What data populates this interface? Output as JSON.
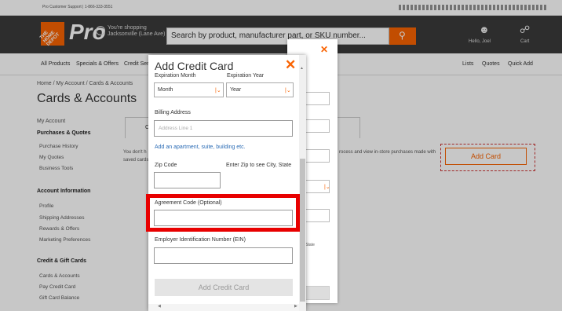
{
  "topbar": {
    "support": "Pro Customer Support | 1-866-333-3551"
  },
  "header": {
    "logo_text": "THE HOME DEPOT",
    "pro_label": "Pro",
    "location_line1": "You're shopping",
    "location_line2": "Jacksonville (Lane Ave)",
    "search_placeholder": "Search by product, manufacturer part, or SKU number...",
    "account_label": "Hello, Joel",
    "cart_label": "Cart"
  },
  "nav": {
    "items": [
      "All Products",
      "Specials & Offers",
      "Credit Servi"
    ],
    "right_items": [
      "Lists",
      "Quotes",
      "Quick Add"
    ]
  },
  "breadcrumb": "Home / My Account / Cards & Accounts",
  "page_title": "Cards & Accounts",
  "sidebar": {
    "my_account": "My Account",
    "purchases_head": "Purchases & Quotes",
    "purchases_items": [
      "Purchase History",
      "My Quotes",
      "Business Tools"
    ],
    "account_head": "Account Information",
    "account_items": [
      "Profile",
      "Shipping Addresses",
      "Rewards & Offers",
      "Marketing Preferences"
    ],
    "credit_head": "Credit & Gift Cards",
    "credit_items": [
      "Cards & Accounts",
      "Pay Credit Card",
      "Gift Card Balance"
    ]
  },
  "main": {
    "tab_label": "C",
    "msg_line1": "You don't h",
    "msg_line2": "saved cards",
    "msg_right": "rocess and view in-store purchases made with",
    "add_card_label": "Add Card"
  },
  "back_modal": {
    "zip_hint": "e City, State"
  },
  "modal": {
    "title": "Add Credit Card",
    "expiration_month_label": "Expiration Month",
    "expiration_year_label": "Expiration Year",
    "month_value": "Month",
    "year_value": "Year",
    "billing_label": "Billing Address",
    "address_placeholder": "Address Line 1",
    "add_apartment_link": "Add an apartment, suite, building etc.",
    "zip_label": "Zip Code",
    "zip_hint": "Enter Zip to see City, State",
    "agreement_label": "Agreement Code (Optional)",
    "ein_label": "Employer Identification Number (EIN)",
    "submit_label": "Add Credit Card"
  }
}
